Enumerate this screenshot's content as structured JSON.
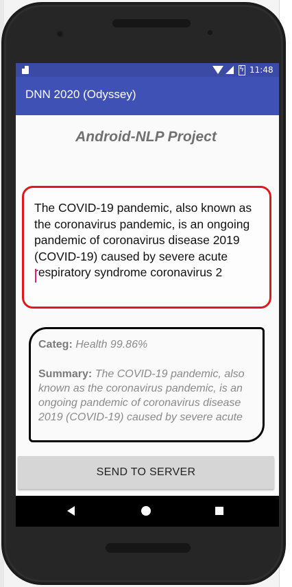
{
  "statusbar": {
    "time": "11:48"
  },
  "appbar": {
    "title": "DNN 2020 (Odyssey)"
  },
  "main": {
    "project_title": "Android-NLP Project",
    "input_text": "The COVID-19 pandemic, also known as the coronavirus pandemic, is an ongoing pandemic of coronavirus disease 2019 (COVID-19) caused by severe acute respiratory syndrome coronavirus 2",
    "result": {
      "category_label": "Categ:",
      "category_value": "Health 99.86%",
      "summary_label": "Summary:",
      "summary_value": "The COVID-19 pandemic, also known as the coronavirus pandemic, is an ongoing pandemic of coronavirus disease 2019 (COVID-19) caused by severe acute"
    },
    "send_button_label": "SEND TO SERVER"
  },
  "icons": {
    "statusbar": [
      "sd-card-icon",
      "wifi-icon",
      "signal-icon",
      "battery-charging-icon"
    ],
    "navbar": [
      "back-icon",
      "home-icon",
      "recents-icon"
    ]
  },
  "colors": {
    "appbar": "#3f51b5",
    "statusbar": "#3b4aa5",
    "input_border": "#e01818",
    "result_border": "#000000",
    "button": "#d6d6d6"
  }
}
